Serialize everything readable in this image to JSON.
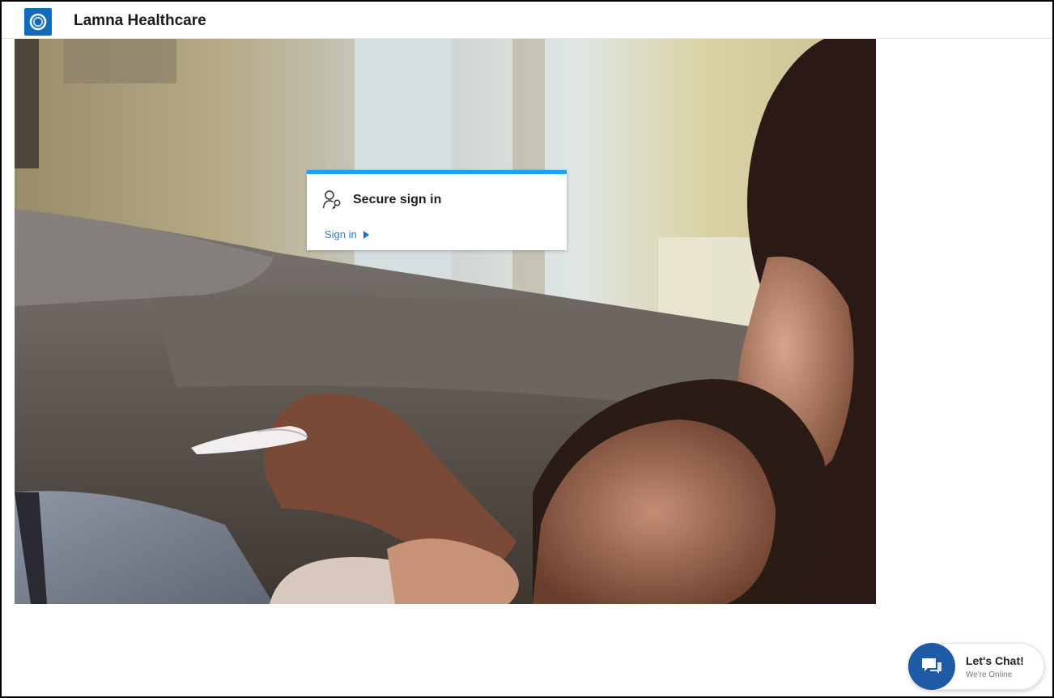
{
  "header": {
    "brand": "Lamna Healthcare",
    "logo_icon": "ring-logo-icon"
  },
  "signin_card": {
    "icon": "user-key-icon",
    "title": "Secure sign in",
    "link_label": "Sign in",
    "accent_color": "#1aa3ee",
    "link_color": "#2b7ed0"
  },
  "hero": {
    "icon": "hero-photo"
  },
  "chat": {
    "icon": "chat-bubbles-icon",
    "title": "Let's Chat!",
    "subtitle": "We're Online",
    "accent_color": "#1f5aa6"
  }
}
